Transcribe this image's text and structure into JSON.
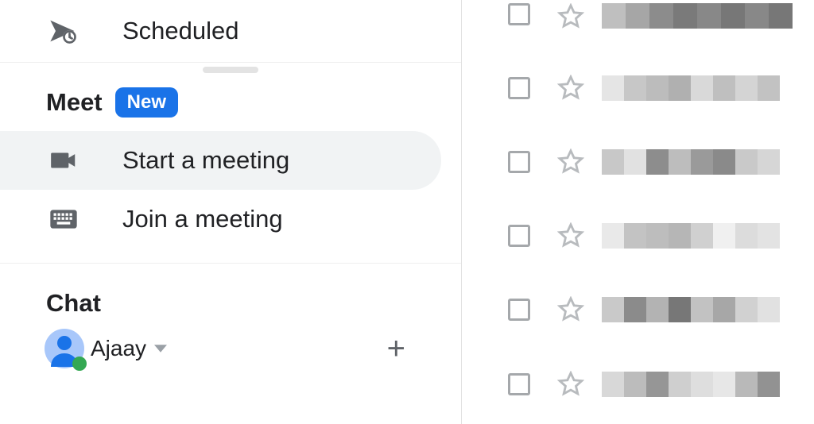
{
  "sidebar": {
    "scheduled_label": "Scheduled",
    "meet_title": "Meet",
    "meet_badge": "New",
    "meet_items": [
      {
        "label": "Start a meeting"
      },
      {
        "label": "Join a meeting"
      }
    ],
    "chat_title": "Chat",
    "chat_user": "Ajaay"
  }
}
